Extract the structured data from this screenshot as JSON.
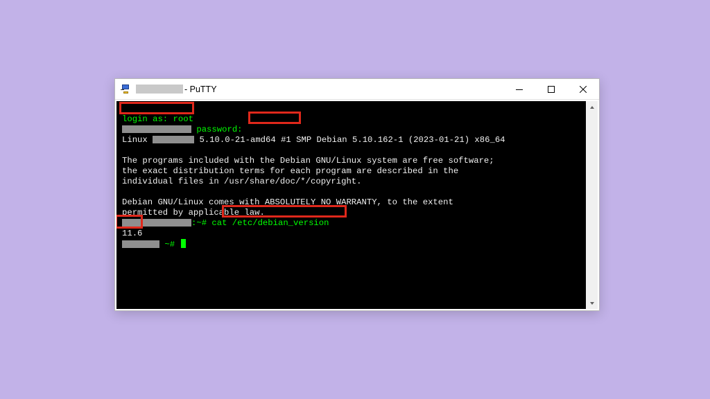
{
  "window": {
    "title_suffix": " - PuTTY"
  },
  "colors": {
    "page_bg": "#c2b2e8",
    "term_bg": "#000000",
    "term_fg": "#f0f0f0",
    "term_green": "#00ff00",
    "anno_red": "#e0281b"
  },
  "term": {
    "login_prompt": "login as: ",
    "login_user": "root",
    "password_label": "password:",
    "kernel_prefix": "Linux ",
    "kernel_line": " 5.10.0-21-amd64 #1 SMP Debian 5.10.162-1 (2023-01-21) x86_64",
    "motd1": "The programs included with the Debian GNU/Linux system are free software;",
    "motd2": "the exact distribution terms for each program are described in the",
    "motd3": "individual files in /usr/share/doc/*/copyright.",
    "motd4": "Debian GNU/Linux comes with ABSOLUTELY NO WARRANTY, to the extent",
    "motd5": "permitted by applicable law.",
    "prompt_tail": ":~# ",
    "cmd": "cat /etc/debian_version",
    "output": "11.6",
    "prompt2_tail": " ~# "
  }
}
